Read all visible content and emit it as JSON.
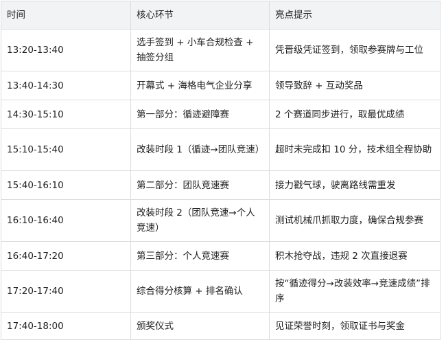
{
  "table": {
    "headers": [
      "时间",
      "核心环节",
      "亮点提示"
    ],
    "rows": [
      {
        "time": "13:20-13:40",
        "segment": "选手签到 + 小车合规检查 + 抽签分组",
        "highlight": "凭晋级凭证签到，领取参赛牌与工位"
      },
      {
        "time": "13:40-14:30",
        "segment": "开幕式 + 海格电气企业分享",
        "highlight": "领导致辞 + 互动奖品"
      },
      {
        "time": "14:30-15:10",
        "segment": "第一部分：循迹避障赛",
        "highlight": "2 个赛道同步进行，取最优成绩"
      },
      {
        "time": "15:10-15:40",
        "segment": "改装时段 1（循迹→团队竞速）",
        "highlight": "超时未完成扣 10 分，技术组全程协助"
      },
      {
        "time": "15:40-16:10",
        "segment": "第二部分：团队竞速赛",
        "highlight": "接力戳气球，驶离路线需重发"
      },
      {
        "time": "16:10-16:40",
        "segment": "改装时段 2（团队竞速→个人竞速）",
        "highlight": "测试机械爪抓取力度，确保合规参赛"
      },
      {
        "time": "16:40-17:20",
        "segment": "第三部分：个人竞速赛",
        "highlight": "积木抢夺战，违规 2 次直接退赛"
      },
      {
        "time": "17:20-17:40",
        "segment": "综合得分核算 + 排名确认",
        "highlight": "按“循迹得分→改装效率→竞速成绩”排序"
      },
      {
        "time": "17:40-18:00",
        "segment": "颁奖仪式",
        "highlight": "见证荣誉时刻，领取证书与奖金"
      }
    ]
  }
}
